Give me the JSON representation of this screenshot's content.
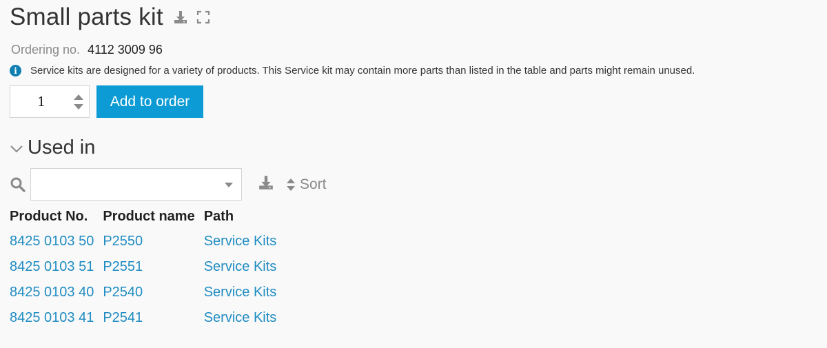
{
  "title": "Small parts kit",
  "icons": {
    "download": "download-icon",
    "expand": "fullscreen-icon",
    "info": "info-icon",
    "search": "search-icon",
    "chevron": "chevron-down-icon",
    "sort": "sort-icon"
  },
  "ordering": {
    "label": "Ordering no.",
    "value": "4112 3009 96"
  },
  "info": {
    "text": "Service kits are designed for a variety of products. This Service kit may contain more parts than listed in the table and parts might remain unused."
  },
  "order": {
    "quantity": "1",
    "add_label": "Add to order"
  },
  "used_in": {
    "title": "Used in",
    "search_placeholder": "",
    "sort_label": "Sort",
    "columns": [
      "Product No.",
      "Product name",
      "Path"
    ],
    "rows": [
      {
        "product_no": "8425 0103 50",
        "product_name": "P2550",
        "path": "Service Kits"
      },
      {
        "product_no": "8425 0103 51",
        "product_name": "P2551",
        "path": "Service Kits"
      },
      {
        "product_no": "8425 0103 40",
        "product_name": "P2540",
        "path": "Service Kits"
      },
      {
        "product_no": "8425 0103 41",
        "product_name": "P2541",
        "path": "Service Kits"
      }
    ]
  },
  "colors": {
    "accent": "#0c9bd4",
    "link": "#1f8cc2",
    "info_icon": "#0f7fb2",
    "background": "#f9f9f9"
  }
}
